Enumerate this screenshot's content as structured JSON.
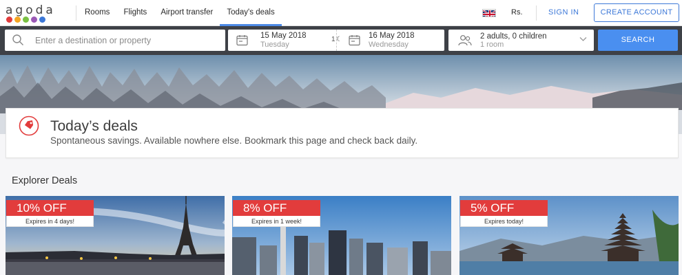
{
  "brand": {
    "name": "agoda",
    "dot_colors": [
      "#e23c3c",
      "#f5a623",
      "#7ac143",
      "#9b59b6",
      "#3c78d8"
    ]
  },
  "nav": {
    "items": [
      {
        "label": "Rooms",
        "active": false
      },
      {
        "label": "Flights",
        "active": false
      },
      {
        "label": "Airport transfer",
        "active": false
      },
      {
        "label": "Today's deals",
        "active": true
      }
    ],
    "currency": "Rs.",
    "sign_in": "SIGN IN",
    "create_account": "CREATE ACCOUNT"
  },
  "search": {
    "destination_placeholder": "Enter a destination or property",
    "check_in_date": "15 May 2018",
    "check_in_day": "Tuesday",
    "nights": "1",
    "check_out_date": "16 May 2018",
    "check_out_day": "Wednesday",
    "guests": "2 adults, 0 children",
    "rooms": "1 room",
    "button": "SEARCH"
  },
  "deals_header": {
    "title": "Today’s deals",
    "subtitle": "Spontaneous savings. Available nowhere else. Bookmark this page and check back daily."
  },
  "explorer": {
    "title": "Explorer Deals",
    "cards": [
      {
        "discount": "10% OFF",
        "expiry": "Expires in 4 days!"
      },
      {
        "discount": "8% OFF",
        "expiry": "Expires in 1 week!"
      },
      {
        "discount": "5% OFF",
        "expiry": "Expires today!"
      }
    ]
  },
  "colors": {
    "accent": "#3c78d8",
    "search_button": "#4a8ff0",
    "search_bar_bg": "#3e4147",
    "discount_badge": "#e23c3c"
  }
}
